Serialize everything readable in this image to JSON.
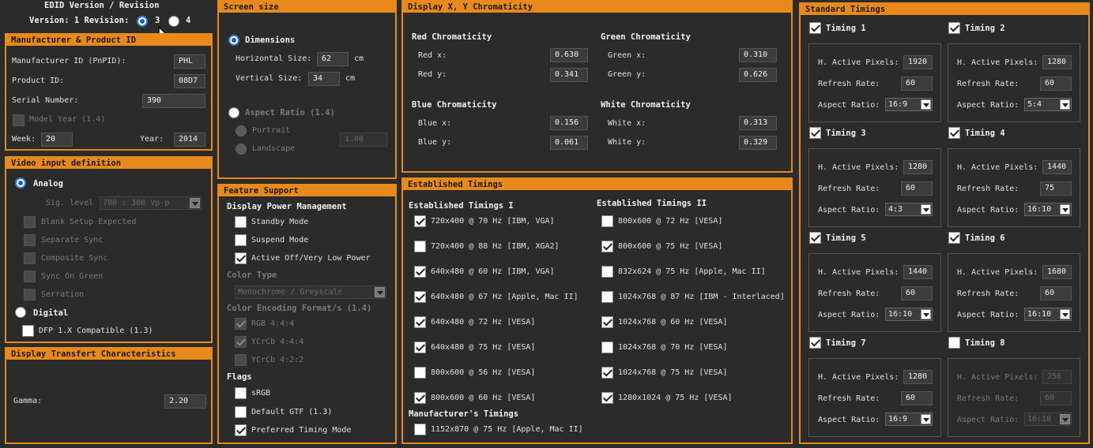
{
  "edid": {
    "title": "EDID Version / Revision",
    "version_label": "Version: 1 Revision:",
    "rev3": "3",
    "rev4": "4"
  },
  "manufacturer": {
    "title": "Manufacturer & Product ID",
    "mfr_label": "Manufacturer ID (PnPID):",
    "mfr_value": "PHL",
    "product_label": "Product ID:",
    "product_value": "08D7",
    "serial_label": "Serial Number:",
    "serial_value": "390",
    "model_year_label": "Model Year (1.4)",
    "week_label": "Week:",
    "week_value": "20",
    "year_label": "Year:",
    "year_value": "2014"
  },
  "video": {
    "title": "Video input definition",
    "analog": "Analog",
    "sig_label": "Sig. level :",
    "sig_value": "700 : 300 Vp-p",
    "opts": [
      "Blank Setup Expected",
      "Separate Sync",
      "Composite Sync",
      "Sync On Green",
      "Serration"
    ],
    "digital": "Digital",
    "dfp": "DFP 1.X Compatible (1.3)"
  },
  "transfer": {
    "title": "Display Transfert Characteristics",
    "gamma_label": "Gamma:",
    "gamma_value": "2.20"
  },
  "screen": {
    "title": "Screen size",
    "dimensions": "Dimensions",
    "h_label": "Horizontal Size:",
    "h_value": "62",
    "h_unit": "cm",
    "v_label": "Vertical Size:",
    "v_value": "34",
    "v_unit": "cm",
    "aspect": "Aspect Ratio (1.4)",
    "portrait": "Portrait",
    "landscape": "Landscape",
    "ratio_value": "1.00"
  },
  "feature": {
    "title": "Feature Support",
    "dpm": "Display Power Management",
    "standby": "Standby Mode",
    "suspend": "Suspend Mode",
    "active_off": "Active Off/Very Low Power",
    "color_type": "Color Type",
    "color_type_value": "Monochrome / Greyscale",
    "encoding": "Color Encoding Format/s (1.4)",
    "rgb": "RGB 4:4:4",
    "ycc444": "YCrCb 4:4:4",
    "ycc422": "YCrCb 4:2:2",
    "flags": "Flags",
    "srgb": "sRGB",
    "default_gtf": "Default GTF (1.3)",
    "preferred": "Preferred Timing Mode"
  },
  "chroma": {
    "title": "Display X, Y Chromaticity",
    "red": "Red Chromaticity",
    "red_x_label": "Red x:",
    "red_x": "0.630",
    "red_y_label": "Red y:",
    "red_y": "0.341",
    "green": "Green Chromaticity",
    "green_x_label": "Green x:",
    "green_x": "0.310",
    "green_y_label": "Green y:",
    "green_y": "0.626",
    "blue": "Blue Chromaticity",
    "blue_x_label": "Blue x:",
    "blue_x": "0.156",
    "blue_y_label": "Blue y:",
    "blue_y": "0.061",
    "white": "White Chromaticity",
    "white_x_label": "White x:",
    "white_x": "0.313",
    "white_y_label": "White y:",
    "white_y": "0.329"
  },
  "established": {
    "title": "Established Timings",
    "group1": "Established Timings I",
    "t1": [
      {
        "label": "720x400 @ 70 Hz [IBM, VGA]",
        "checked": true
      },
      {
        "label": "720x400 @ 88 Hz [IBM, XGA2]",
        "checked": false
      },
      {
        "label": "640x480 @ 60 Hz [IBM, VGA]",
        "checked": true
      },
      {
        "label": "640x480 @ 67 Hz [Apple, Mac II]",
        "checked": true
      },
      {
        "label": "640x480 @ 72 Hz [VESA]",
        "checked": true
      },
      {
        "label": "640x480 @ 75 Hz [VESA]",
        "checked": true
      },
      {
        "label": "800x600 @ 56 Hz [VESA]",
        "checked": false
      },
      {
        "label": "800x600 @ 60 Hz [VESA]",
        "checked": true
      }
    ],
    "group2": "Established Timings II",
    "t2": [
      {
        "label": "800x600 @ 72 Hz [VESA]",
        "checked": false
      },
      {
        "label": "800x600 @ 75 Hz [VESA]",
        "checked": true
      },
      {
        "label": "832x624 @ 75 Hz [Apple, Mac II]",
        "checked": false
      },
      {
        "label": "1024x768 @ 87 Hz [IBM - Interlaced]",
        "checked": false
      },
      {
        "label": "1024x768 @ 60 Hz [VESA]",
        "checked": true
      },
      {
        "label": "1024x768 @ 70 Hz [VESA]",
        "checked": false
      },
      {
        "label": "1024x768 @ 75 Hz [VESA]",
        "checked": true
      },
      {
        "label": "1280x1024 @ 75 Hz [VESA]",
        "checked": true
      }
    ],
    "mfr_title": "Manufacturer's Timings",
    "mfr_item": "1152x870 @ 75 Hz [Apple, Mac II]"
  },
  "standard": {
    "title": "Standard Timings",
    "h_label": "H. Active Pixels:",
    "r_label": "Refresh Rate:",
    "a_label": "Aspect Ratio:",
    "timings": [
      {
        "name": "Timing 1",
        "checked": true,
        "h": "1920",
        "r": "60",
        "a": "16:9"
      },
      {
        "name": "Timing 2",
        "checked": true,
        "h": "1280",
        "r": "60",
        "a": "5:4"
      },
      {
        "name": "Timing 3",
        "checked": true,
        "h": "1280",
        "r": "60",
        "a": "4:3"
      },
      {
        "name": "Timing 4",
        "checked": true,
        "h": "1440",
        "r": "75",
        "a": "16:10"
      },
      {
        "name": "Timing 5",
        "checked": true,
        "h": "1440",
        "r": "60",
        "a": "16:10"
      },
      {
        "name": "Timing 6",
        "checked": true,
        "h": "1680",
        "r": "60",
        "a": "16:10"
      },
      {
        "name": "Timing 7",
        "checked": true,
        "h": "1280",
        "r": "60",
        "a": "16:9"
      },
      {
        "name": "Timing 8",
        "checked": false,
        "h": "256",
        "r": "60",
        "a": "16:10"
      }
    ]
  },
  "colors": {
    "accent": "#e8891c",
    "bg": "#2b2b2b"
  }
}
